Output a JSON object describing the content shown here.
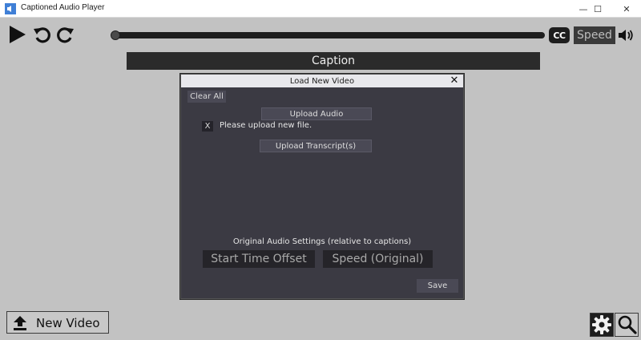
{
  "window": {
    "title": "Captioned Audio Player",
    "minimize": "—",
    "maximize": "☐",
    "close": "✕"
  },
  "toolbar": {
    "icons": [
      "play-icon",
      "rewind-icon",
      "forward-icon",
      "volume-icon"
    ],
    "cc_label": "CC",
    "speed_label": "Speed",
    "progress": 0
  },
  "caption": {
    "text": "Caption"
  },
  "dialog": {
    "title": "Load New Video",
    "close_label": "✕",
    "clear_all": "Clear All",
    "upload_audio": "Upload Audio",
    "status_mark": "X",
    "status_text": "Please upload new file.",
    "upload_transcripts": "Upload Transcript(s)",
    "settings_label": "Original Audio Settings (relative to captions)",
    "start_time_offset": "Start Time Offset",
    "speed_original": "Speed (Original)",
    "save": "Save"
  },
  "footer": {
    "new_video": "New Video",
    "icons": [
      "upload-icon",
      "gear-icon",
      "search-icon"
    ]
  },
  "colors": {
    "background": "#c2c2c2",
    "dialog": "#3b3a43",
    "dark": "#1e1e1e"
  }
}
